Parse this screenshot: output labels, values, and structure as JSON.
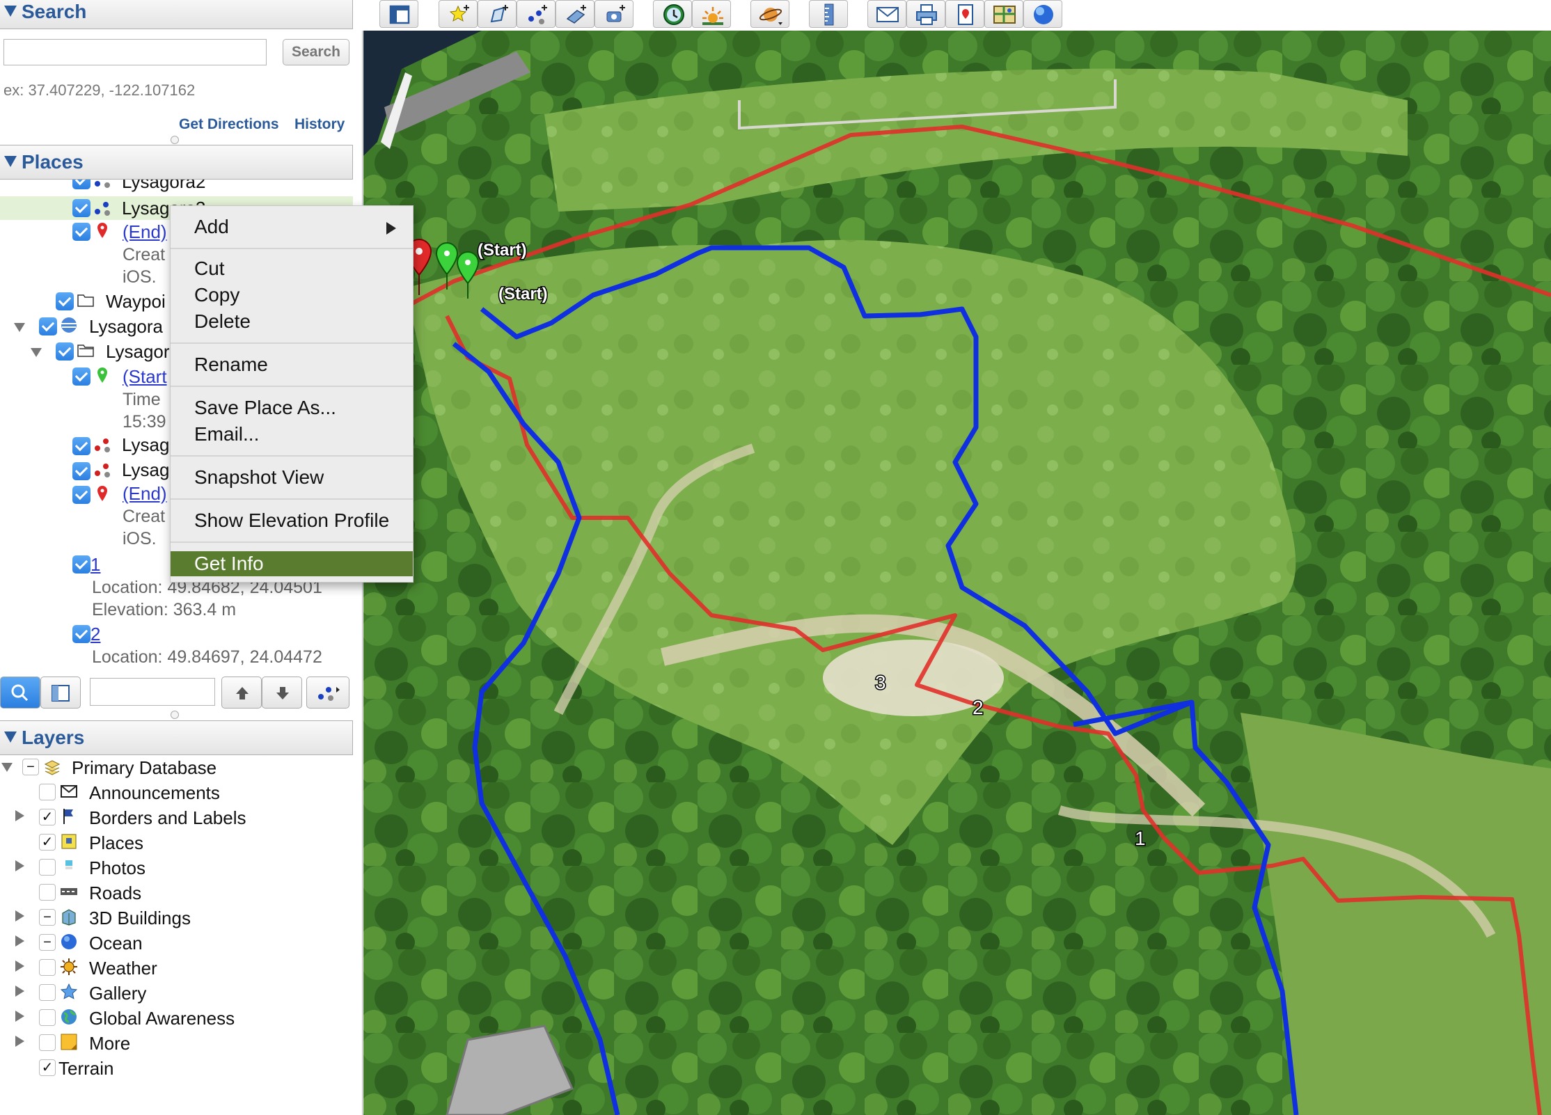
{
  "search": {
    "header": "Search",
    "button": "Search",
    "hint": "ex: 37.407229, -122.107162",
    "get_directions": "Get Directions",
    "history": "History"
  },
  "places": {
    "header": "Places",
    "items": [
      {
        "label": "Lysagora2"
      },
      {
        "label": "Lysagora3"
      },
      {
        "label": "(End)"
      },
      {
        "label": "Creat"
      },
      {
        "label": "iOS."
      },
      {
        "label": "Waypoi"
      },
      {
        "label": "Lysagora"
      },
      {
        "label": "Lysagor"
      },
      {
        "label": "(Start"
      },
      {
        "label": "Time"
      },
      {
        "label": "15:39"
      },
      {
        "label": "Lysag"
      },
      {
        "label": "Lysag"
      },
      {
        "label": "(End)"
      },
      {
        "label": "Creat"
      },
      {
        "label": "iOS."
      },
      {
        "label": "1"
      },
      {
        "label": "Location: 49.84682, 24.04501"
      },
      {
        "label": "Elevation: 363.4 m"
      },
      {
        "label": "2"
      },
      {
        "label": "Location: 49.84697, 24.04472"
      }
    ]
  },
  "context_menu": {
    "items": [
      {
        "label": "Add"
      },
      {
        "label": "Cut"
      },
      {
        "label": "Copy"
      },
      {
        "label": "Delete"
      },
      {
        "label": "Rename"
      },
      {
        "label": "Save Place As..."
      },
      {
        "label": "Email..."
      },
      {
        "label": "Snapshot View"
      },
      {
        "label": "Show Elevation Profile"
      },
      {
        "label": "Get Info"
      }
    ]
  },
  "layers": {
    "header": "Layers",
    "items": [
      {
        "label": "Primary Database"
      },
      {
        "label": "Announcements"
      },
      {
        "label": "Borders and Labels"
      },
      {
        "label": "Places"
      },
      {
        "label": "Photos"
      },
      {
        "label": "Roads"
      },
      {
        "label": "3D Buildings"
      },
      {
        "label": "Ocean"
      },
      {
        "label": "Weather"
      },
      {
        "label": "Gallery"
      },
      {
        "label": "Global Awareness"
      },
      {
        "label": "More"
      },
      {
        "label": "Terrain"
      }
    ]
  },
  "map": {
    "labels": {
      "start1": "(Start)",
      "start2": "(Start)",
      "wp3": "3",
      "wp2": "2",
      "wp1": "1"
    }
  },
  "colors": {
    "accent": "#2a5a9a",
    "menu_highlight": "#5a7c2e",
    "track_red": "#e0302a",
    "track_blue": "#1030e0"
  }
}
